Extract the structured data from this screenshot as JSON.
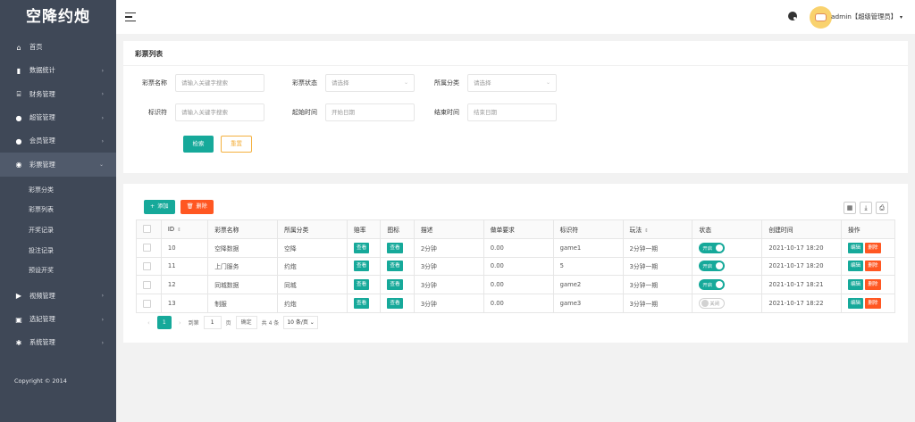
{
  "brand": "空降约炮",
  "sidebar": {
    "items": [
      {
        "label": "首页",
        "icon": "home-icon",
        "glyph": "⌂"
      },
      {
        "label": "数据统计",
        "icon": "bar-chart-icon",
        "glyph": "▮",
        "arrow": "›"
      },
      {
        "label": "财务管理",
        "icon": "bank-icon",
        "glyph": "⌸",
        "arrow": "›"
      },
      {
        "label": "超管管理",
        "icon": "user-icon",
        "glyph": "●",
        "arrow": "›"
      },
      {
        "label": "会员管理",
        "icon": "users-icon",
        "glyph": "●",
        "arrow": "›"
      },
      {
        "label": "彩票管理",
        "icon": "gamepad-icon",
        "glyph": "◉",
        "arrow": "⌄"
      }
    ],
    "sub_items": [
      "彩票分类",
      "彩票列表",
      "开奖记录",
      "投注记录",
      "预设开奖"
    ],
    "items_after": [
      {
        "label": "视频管理",
        "icon": "video-icon",
        "glyph": "▶",
        "arrow": "›"
      },
      {
        "label": "选妃管理",
        "icon": "select-icon",
        "glyph": "▣",
        "arrow": "›"
      },
      {
        "label": "系统管理",
        "icon": "gear-icon",
        "glyph": "✱",
        "arrow": "›"
      }
    ],
    "copyright": "Copyright © 2014"
  },
  "header": {
    "user": "admin【超级管理员】",
    "caret": "▾"
  },
  "search": {
    "title": "彩票列表",
    "fields": {
      "name_label": "彩票名称",
      "name_placeholder": "请输入关键字搜索",
      "status_label": "彩票状态",
      "status_placeholder": "请选择",
      "category_label": "所属分类",
      "category_placeholder": "请选择",
      "code_label": "标识符",
      "code_placeholder": "请输入关键字搜索",
      "start_label": "起始时间",
      "start_placeholder": "开始日期",
      "end_label": "结束时间",
      "end_placeholder": "结束日期"
    },
    "search_button": "检索",
    "reset_button": "重置",
    "select_caret": "⌄"
  },
  "table": {
    "add_button": "添加",
    "delete_button": "删除",
    "add_glyph": "+",
    "delete_glyph": "🗑",
    "columns": [
      "ID",
      "彩票名称",
      "所属分类",
      "赔率",
      "图标",
      "描述",
      "做单要求",
      "标识符",
      "玩法",
      "状态",
      "创建时间",
      "操作"
    ],
    "sort_glyph": "⇕",
    "view_label": "查看",
    "edit_label": "编辑",
    "del_label": "删除",
    "on_label": "开启",
    "off_label": "关闭",
    "rows": [
      {
        "id": "10",
        "name": "空降数据",
        "category": "空降",
        "desc": "2分钟",
        "requirement": "0.00",
        "code": "game1",
        "play": "2分钟一期",
        "status": "on",
        "created": "2021-10-17 18:20"
      },
      {
        "id": "11",
        "name": "上门服务",
        "category": "约炮",
        "desc": "3分钟",
        "requirement": "0.00",
        "code": "5",
        "play": "3分钟一期",
        "status": "on",
        "created": "2021-10-17 18:20"
      },
      {
        "id": "12",
        "name": "同城数据",
        "category": "同城",
        "desc": "3分钟",
        "requirement": "0.00",
        "code": "game2",
        "play": "3分钟一期",
        "status": "on",
        "created": "2021-10-17 18:21"
      },
      {
        "id": "13",
        "name": "制服",
        "category": "约炮",
        "desc": "3分钟",
        "requirement": "0.00",
        "code": "game3",
        "play": "3分钟一期",
        "status": "off",
        "created": "2021-10-17 18:22"
      }
    ]
  },
  "pager": {
    "prev": "‹",
    "current": "1",
    "next": "›",
    "goto_label": "到第",
    "goto_value": "1",
    "page_unit": "页",
    "confirm": "确定",
    "total": "共 4 条",
    "page_size": "10 条/页 ⌄"
  },
  "colors": {
    "sidebar_bg": "#3f4857",
    "accent": "#16a99a",
    "danger": "#ff5722",
    "warn": "#f4b03e"
  }
}
